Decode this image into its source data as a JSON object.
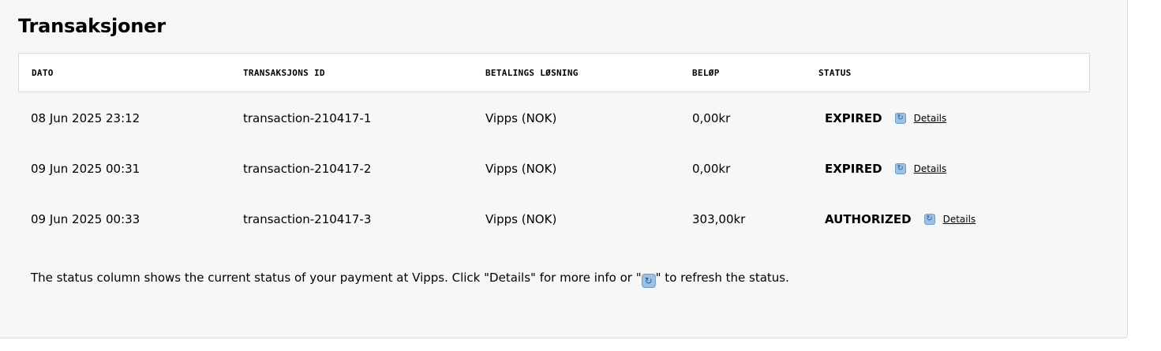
{
  "section": {
    "title": "Transaksjoner"
  },
  "table": {
    "headers": {
      "date": "DATO",
      "transaction_id": "TRANSAKSJONS ID",
      "payment_method": "BETALINGS LØSNING",
      "amount": "BELØP",
      "status": "STATUS"
    },
    "rows": [
      {
        "date": "08 Jun 2025 23:12",
        "transaction_id": "transaction-210417-1",
        "payment_method": "Vipps (NOK)",
        "amount": "0,00kr",
        "status": "EXPIRED",
        "details_label": "Details",
        "refresh_icon": "refresh-icon"
      },
      {
        "date": "09 Jun 2025 00:31",
        "transaction_id": "transaction-210417-2",
        "payment_method": "Vipps (NOK)",
        "amount": "0,00kr",
        "status": "EXPIRED",
        "details_label": "Details",
        "refresh_icon": "refresh-icon"
      },
      {
        "date": "09 Jun 2025 00:33",
        "transaction_id": "transaction-210417-3",
        "payment_method": "Vipps (NOK)",
        "amount": "303,00kr",
        "status": "AUTHORIZED",
        "details_label": "Details",
        "refresh_icon": "refresh-icon"
      }
    ]
  },
  "info": {
    "before": "The status column shows the current status of your payment at Vipps. Click \"Details\" for more info or \"",
    "icon": "refresh-icon",
    "after": "\" to refresh the status."
  },
  "colors": {
    "panel_bg": "#f7f7f7",
    "header_bg": "#ffffff",
    "refresh_icon_bg": "#9ec1e4"
  }
}
